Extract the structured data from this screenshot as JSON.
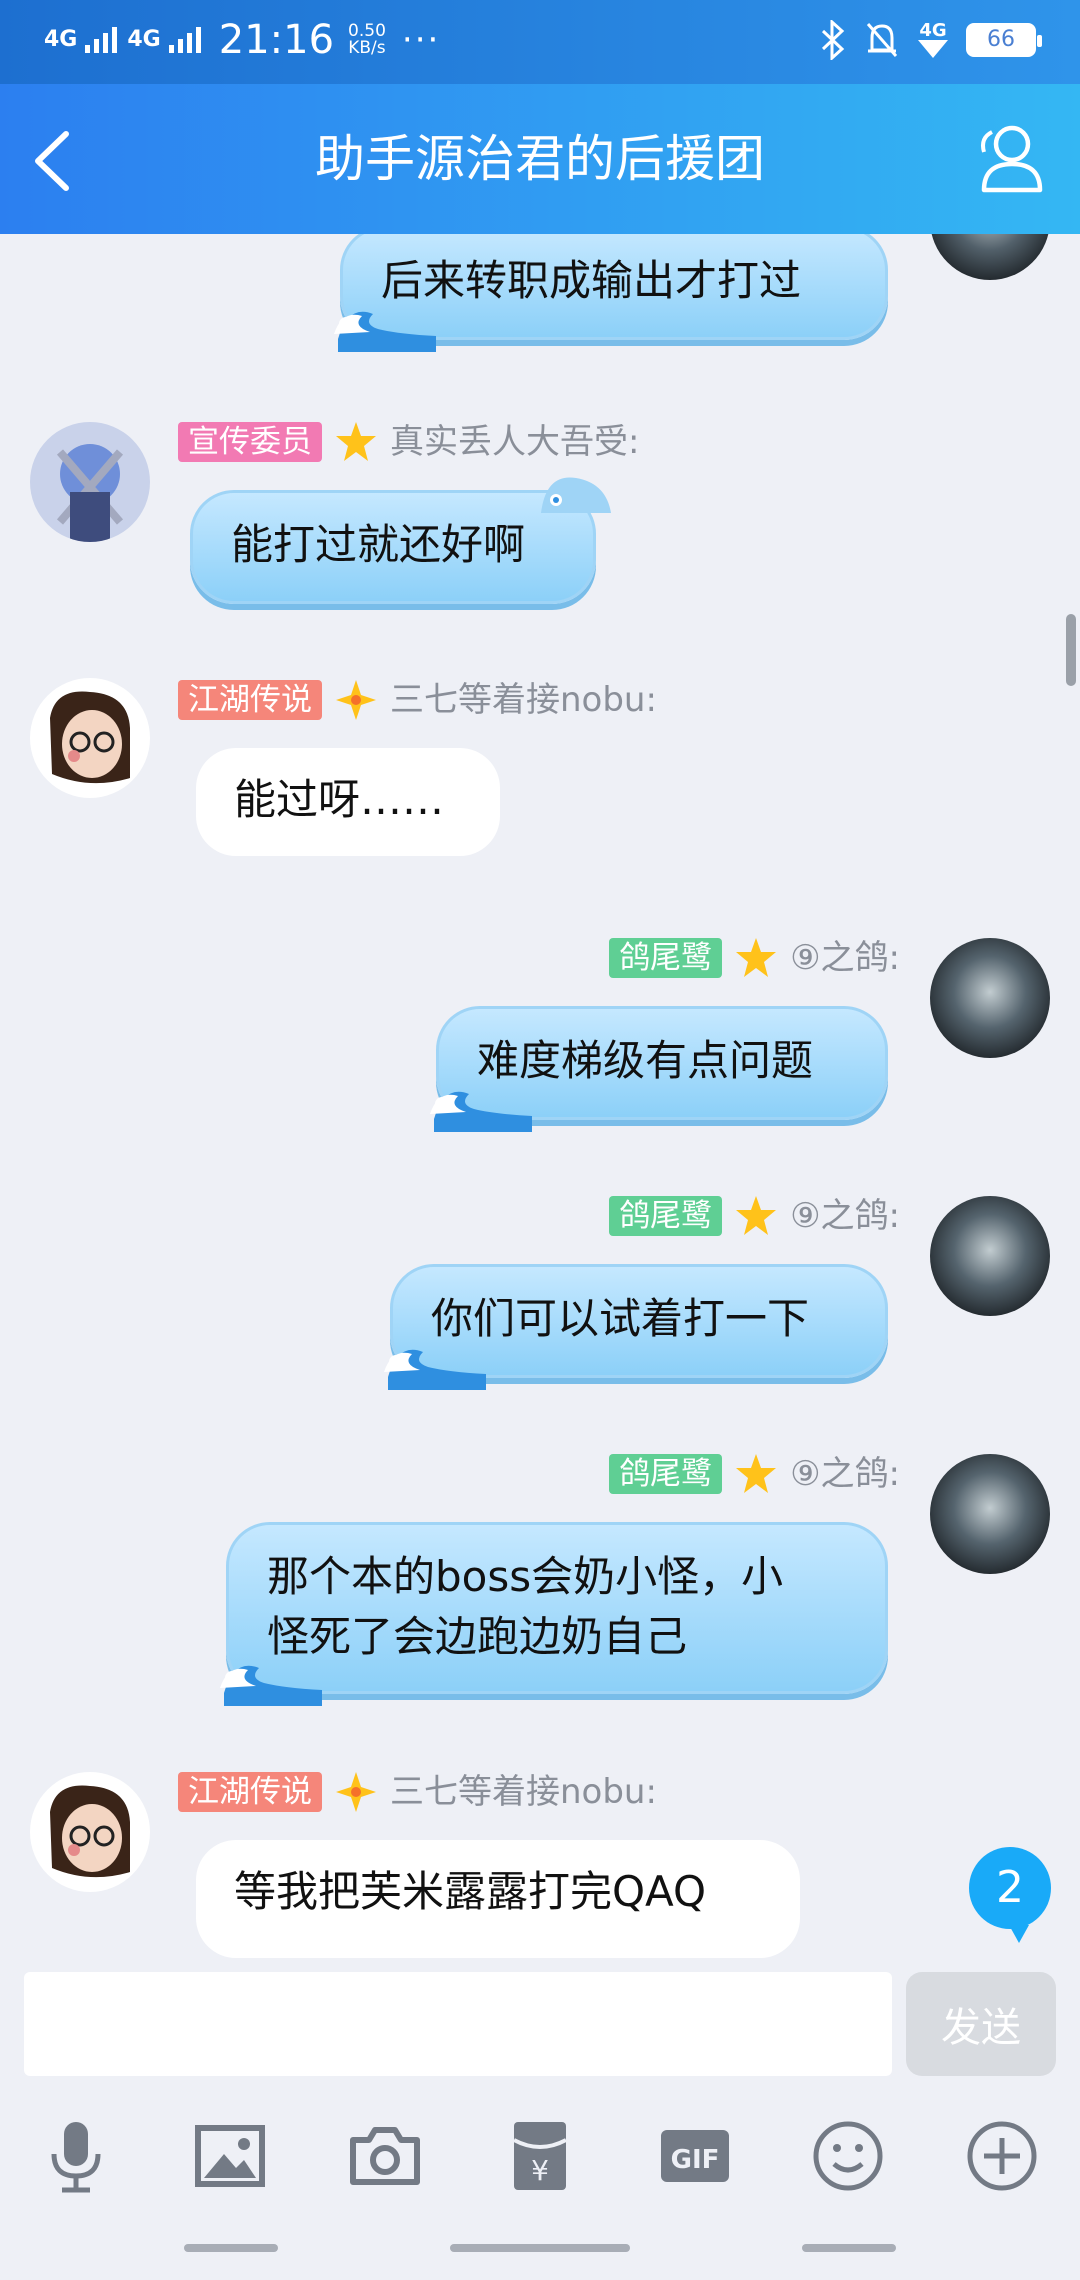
{
  "status_bar": {
    "signal1": "4G",
    "signal2": "4G",
    "time": "21:16",
    "speed_value": "0.50",
    "speed_unit": "KB/s",
    "more": "···",
    "signal3": "4G",
    "battery": "66"
  },
  "header": {
    "title": "助手源治君的后援团"
  },
  "messages": [
    {
      "side": "right",
      "text": "后来转职成输出才打过"
    },
    {
      "side": "left",
      "tag": "宣传委员",
      "nick": "真实丢人大吾受:",
      "text": "能打过就还好啊"
    },
    {
      "side": "left",
      "tag": "江湖传说",
      "nick": "三七等着接nobu:",
      "text": "能过呀……"
    },
    {
      "side": "right",
      "tag": "鸽尾鹭",
      "nick": "⑨之鸽:",
      "text": "难度梯级有点问题"
    },
    {
      "side": "right",
      "tag": "鸽尾鹭",
      "nick": "⑨之鸽:",
      "text": "你们可以试着打一下"
    },
    {
      "side": "right",
      "tag": "鸽尾鹭",
      "nick": "⑨之鸽:",
      "text_line1": "那个本的boss会奶小怪，小",
      "text_line2": "怪死了会边跑边奶自己"
    },
    {
      "side": "left",
      "tag": "江湖传说",
      "nick": "三七等着接nobu:",
      "text": "等我把芙米露露打完QAQ"
    }
  ],
  "unread_count": "2",
  "input": {
    "value": "",
    "send_label": "发送"
  },
  "colors": {
    "tag_pink": "#f27ab3",
    "tag_orange": "#f5867a",
    "tag_green": "#5fcf94",
    "accent": "#2c8ef0"
  },
  "toolbar_icons": [
    "microphone-icon",
    "image-icon",
    "camera-icon",
    "red-packet-icon",
    "gif-icon",
    "emoji-icon",
    "plus-icon"
  ]
}
